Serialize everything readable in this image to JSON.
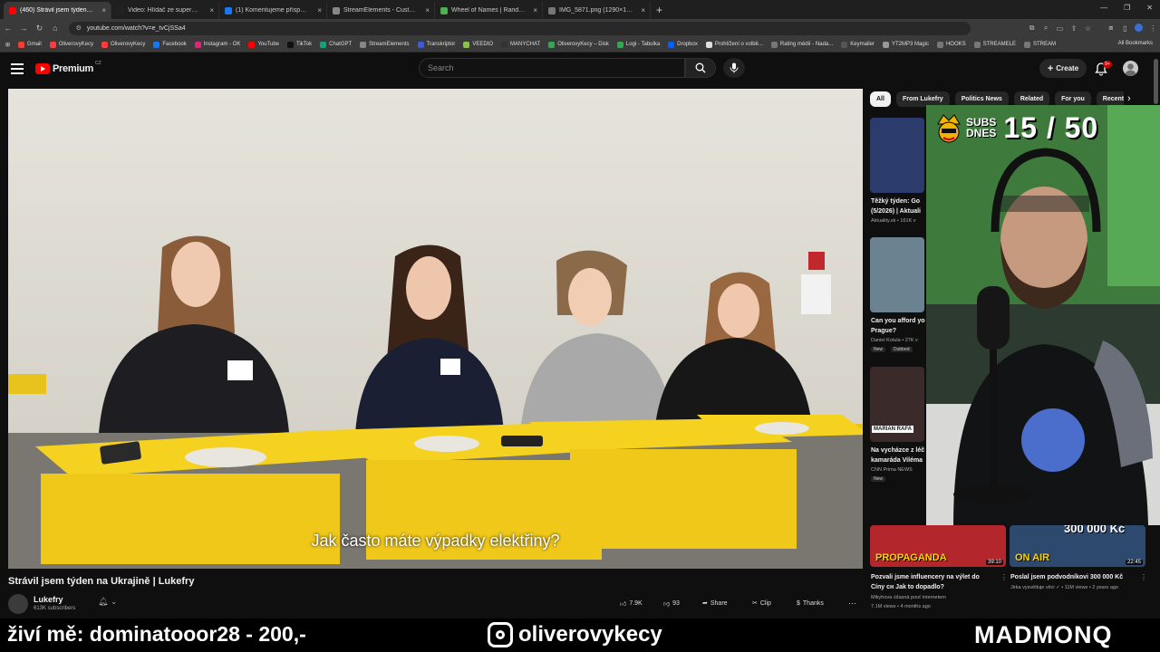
{
  "tabs": [
    {
      "label": "(460) Strávil jsem týden na",
      "color": "#ff0000",
      "close": "×",
      "active": true
    },
    {
      "label": "Video: Hlídač ze supermarketu",
      "color": "#222",
      "close": "×"
    },
    {
      "label": "(1) Komentujeme příspěvky de",
      "color": "#1877f2",
      "close": "×"
    },
    {
      "label": "StreamElements - Custom com",
      "color": "#888",
      "close": "×"
    },
    {
      "label": "Wheel of Names | Random nam",
      "color": "#4caf50",
      "close": "×"
    },
    {
      "label": "IMG_5871.png (1290×1253)",
      "color": "#777",
      "close": "×"
    }
  ],
  "browser": {
    "new_tab": "+",
    "url": "youtube.com/watch?v=e_tvCjSSa4"
  },
  "bookmarks": [
    "Gmail",
    "OliverovyKecy",
    "OliverovyKecy",
    "Facebook",
    "Instagram - OK",
    "YouTube",
    "TikTok",
    "ChatGPT",
    "StreamElements",
    "Transkriptor",
    "VEEDIO",
    "MANYCHAT",
    "OliverovyKecy – Disk",
    "Logi - Tabulka",
    "Dropbox",
    "Prohlížení o volbě...",
    "Rating médií - Nada...",
    "Keymailer",
    "YT2MP3 Magic",
    "HOOKS",
    "STREAMELE",
    "STREAM"
  ],
  "all_bookmarks": "All Bookmarks",
  "yt": {
    "logo": "Premium",
    "region": "CZ",
    "search_placeholder": "Search",
    "create": "Create",
    "notif_count": "9+"
  },
  "video": {
    "subtitle": "Jak často máte výpadky elektřiny?",
    "title": "Strávil jsem týden na Ukrajině | Lukefry",
    "channel": "Lukefry",
    "subscribers": "613K subscribers",
    "likes": "7.9K",
    "dislikes": "93",
    "share": "Share",
    "clip": "Clip",
    "thanks": "Thanks",
    "more": "···"
  },
  "chips": [
    "All",
    "From Lukefry",
    "Politics News",
    "Related",
    "For you",
    "Recently uploaded"
  ],
  "side": [
    {
      "title": "Těžký týden: Go",
      "title2": "(5/2026) | Aktuali",
      "meta": "Aktuality.sk • 161K v",
      "badges": []
    },
    {
      "title": "Can you afford yo",
      "title2": "Prague?",
      "meta": "Daniel Kotula • 27K v",
      "badges": [
        "New",
        "Dubbed"
      ]
    },
    {
      "title": "Na vycházce z léč",
      "title2": "kamaráda Viléma",
      "meta": "CNN Prima NEWS",
      "badges": [
        "New"
      ],
      "thumb_text": "MARIAN RAFA"
    }
  ],
  "side_bottom": [
    {
      "title": "Pozvali jsme influencery na výlet do",
      "title2": "Číny сн Jak to dopadlo?",
      "meta": "Mikyhova úžasná pouť internetem",
      "meta2": "7.1M views • 4 months ago",
      "duration": "39:10",
      "thumb_text": "PROPAGANDA"
    },
    {
      "title": "Poslal jsem podvodníkovi 300 000 Kč",
      "meta": "Jirka vysvětluje věci ✓ • 11M views • 2 years ago",
      "duration": "22:45",
      "thumb_text": "ON AIR",
      "thumb_text2": "300 000 Kč"
    }
  ],
  "overlay": {
    "subs_label_1": "SUBS",
    "subs_label_2": "DNES",
    "subs_count": "15 / 50"
  },
  "bottom": {
    "live": "živí mě: dominatooor28 - 200,-",
    "instagram": "oliverovykecy",
    "brand": "MADMONQ"
  }
}
